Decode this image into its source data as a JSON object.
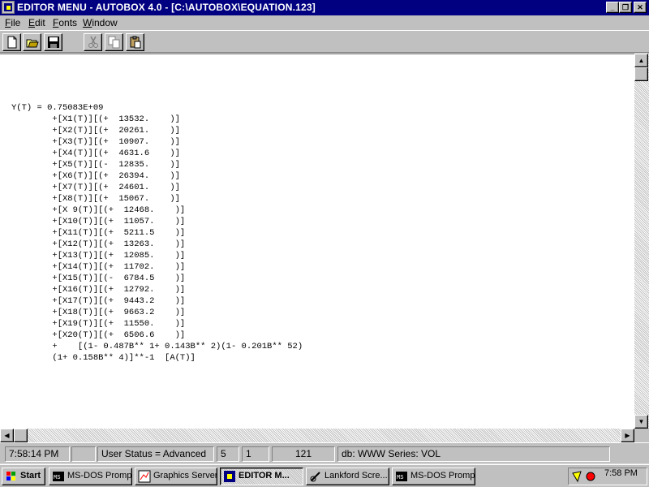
{
  "window": {
    "title": "EDITOR MENU - AUTOBOX 4.0 - [C:\\AUTOBOX\\EQUATION.123]",
    "minimize_glyph": "_",
    "restore_glyph": "❐",
    "close_glyph": "✕"
  },
  "menu": {
    "file": {
      "first": "F",
      "rest": "ile"
    },
    "edit": {
      "first": "E",
      "rest": "dit"
    },
    "fonts": {
      "first": "F",
      "rest": "onts"
    },
    "window": {
      "first": "W",
      "rest": "indow"
    }
  },
  "toolbar": {
    "buttons": [
      "new-icon",
      "open-icon",
      "save-icon",
      "cut-icon",
      "copy-icon",
      "paste-icon"
    ]
  },
  "editor": {
    "lines": [
      "Y(T) = 0.75083E+09",
      "        +[X1(T)][(+  13532.    )]",
      "        +[X2(T)][(+  20261.    )]",
      "        +[X3(T)][(+  10907.    )]",
      "        +[X4(T)][(+  4631.6    )]",
      "        +[X5(T)][(-  12835.    )]",
      "        +[X6(T)][(+  26394.    )]",
      "        +[X7(T)][(+  24601.    )]",
      "        +[X8(T)][(+  15067.    )]",
      "        +[X 9(T)][(+  12468.    )]",
      "        +[X10(T)][(+  11057.    )]",
      "        +[X11(T)][(+  5211.5    )]",
      "        +[X12(T)][(+  13263.    )]",
      "        +[X13(T)][(+  12085.    )]",
      "        +[X14(T)][(+  11702.    )]",
      "        +[X15(T)][(-  6784.5    )]",
      "        +[X16(T)][(+  12792.    )]",
      "        +[X17(T)][(+  9443.2    )]",
      "        +[X18(T)][(+  9663.2    )]",
      "        +[X19(T)][(+  11550.    )]",
      "        +[X20(T)][(+  6506.6    )]",
      "        +    [(1- 0.487B** 1+ 0.143B** 2)(1- 0.201B** 52)",
      "        (1+ 0.158B** 4)]**-1  [A(T)]"
    ]
  },
  "status": {
    "time": "7:58:14 PM",
    "empty": "",
    "user_status": "User Status = Advanced",
    "field_a": "5",
    "field_b": "1",
    "field_c": "121",
    "db": "db: WWW Series: VOL"
  },
  "taskbar": {
    "start": "Start",
    "tasks": [
      {
        "label": "MS-DOS Prompt",
        "icon": "msdos-icon"
      },
      {
        "label": "Graphics Server",
        "icon": "graphics-icon"
      },
      {
        "label": "EDITOR M...",
        "icon": "autobox-icon"
      },
      {
        "label": "Lankford Scre...",
        "icon": "lankford-icon"
      },
      {
        "label": "MS-DOS Prompt",
        "icon": "msdos-icon"
      }
    ],
    "clock": "7:58 PM"
  },
  "colors": {
    "titlebar": "#000080",
    "face": "#c0c0c0",
    "editor_bg": "#ffffff"
  }
}
